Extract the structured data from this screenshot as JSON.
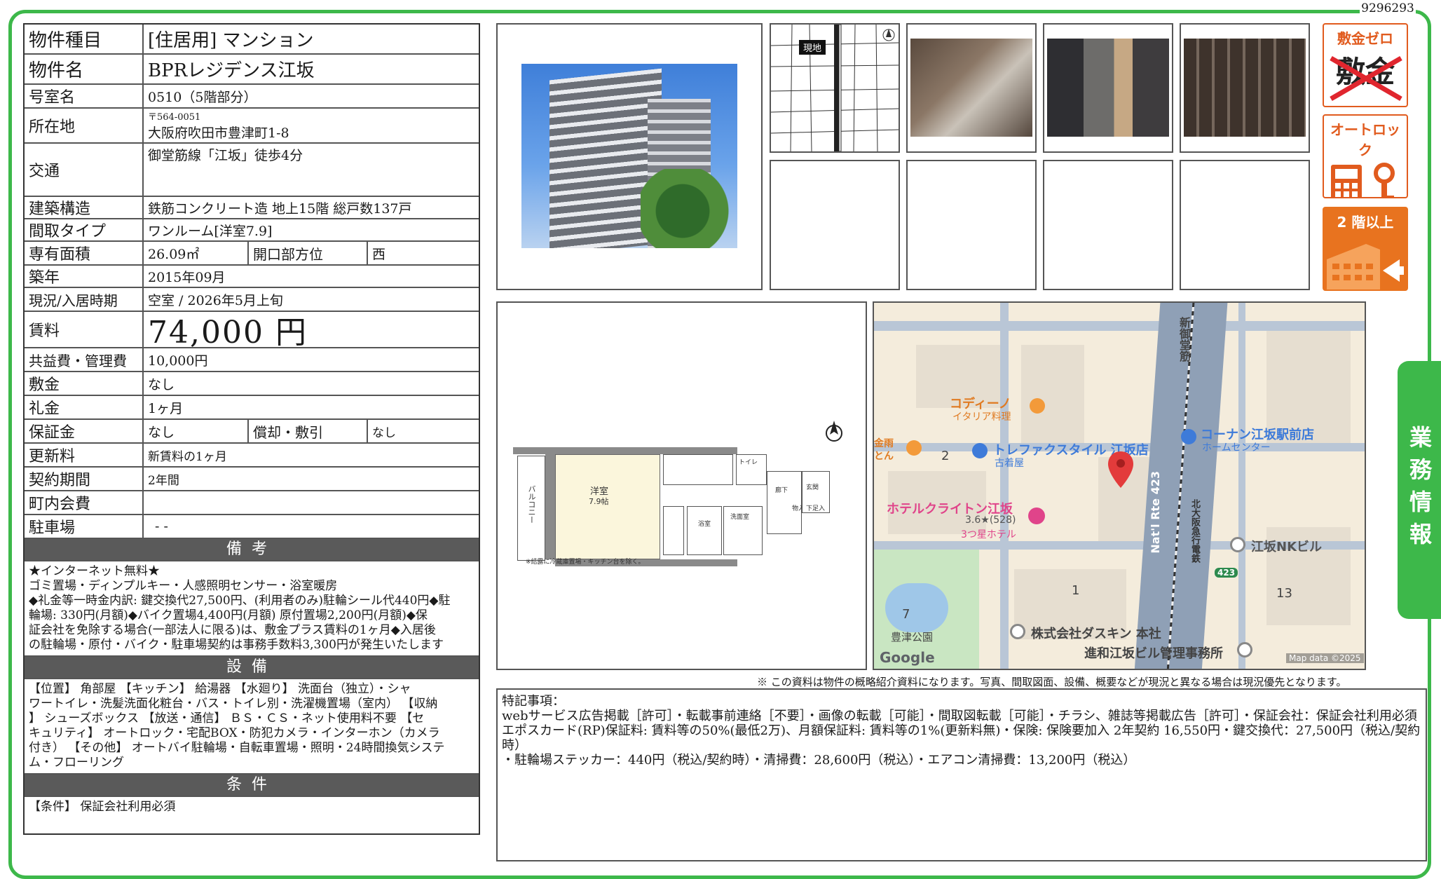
{
  "ref_id": "9296293",
  "side_tab": "業務情報",
  "spec": {
    "type_label": "物件種目",
    "type_value": "[住居用]  マンション",
    "name_label": "物件名",
    "name_value": "BPRレジデンス江坂",
    "room_label": "号室名",
    "room_value": "0510（5階部分）",
    "address_label": "所在地",
    "postal": "〒564-0051",
    "address_value": "大阪府吹田市豊津町1-8",
    "access_label": "交通",
    "access_value": "御堂筋線「江坂」徒歩4分",
    "structure_label": "建築構造",
    "structure_value": "鉄筋コンクリート造  地上15階  総戸数137戸",
    "layout_label": "間取タイプ",
    "layout_value": "ワンルーム[洋室7.9]",
    "area_label": "専有面積",
    "area_value": "26.09㎡",
    "direction_label": "開口部方位",
    "direction_value": "西",
    "built_label": "築年",
    "built_value": "2015年09月",
    "status_label": "現況/入居時期",
    "status_value": "空室  /  2026年5月上旬",
    "rent_label": "賃料",
    "rent_value": "74,000 円",
    "fee_label": "共益費・管理費",
    "fee_value": "10,000円",
    "deposit_label": "敷金",
    "deposit_value": "なし",
    "key_label": "礼金",
    "key_value": "1ヶ月",
    "guarantee_label": "保証金",
    "guarantee_value": "なし",
    "amort_label": "償却・敷引",
    "amort_value": "なし",
    "renew_label": "更新料",
    "renew_value": "新賃料の1ヶ月",
    "contract_label": "契約期間",
    "contract_value": "2年間",
    "town_label": "町内会費",
    "town_value": "",
    "parking_label": "駐車場",
    "parking_value": "- -"
  },
  "remarks": {
    "title": "備考",
    "lines": [
      "★インターネット無料★",
      "ゴミ置場・ディンプルキー・人感照明センサー・浴室暖房",
      "◆礼金等一時金内訳: 鍵交換代27,500円、(利用者のみ)駐輪シール代440円◆駐",
      "輪場: 330円(月額)◆バイク置場4,400円(月額)  原付置場2,200円(月額)◆保",
      "証会社を免除する場合(一部法人に限る)は、敷金プラス賃料の1ヶ月◆入居後",
      "の駐輪場・原付・バイク・駐車場契約は事務手数料3,300円が発生いたします"
    ]
  },
  "facilities": {
    "title": "設備",
    "lines": [
      "【位置】 角部屋 【キッチン】 給湯器 【水廻り】 洗面台（独立）・シャ",
      "ワートイレ・洗髪洗面化粧台・バス・トイレ別・洗濯機置場（室内） 【収納",
      "】 シューズボックス 【放送・通信】 ＢＳ・ＣＳ・ネット使用料不要 【セ",
      "キュリティ】 オートロック・宅配BOX・防犯カメラ・インターホン（カメラ",
      "付き） 【その他】 オートバイ駐輪場・自転車置場・照明・24時間換気システ",
      "ム・フローリング"
    ]
  },
  "conditions": {
    "title": "条件",
    "text": "【条件】 保証会社利用必須"
  },
  "badges": {
    "zero_title": "敷金ゼロ",
    "zero_crossed": "敷金",
    "autolock_title": "オートロック",
    "second_floor_title": "2 階以上"
  },
  "thumb_map": {
    "here_label": "現地"
  },
  "floor_plan": {
    "room": "洋室",
    "room_size": "7.9帖",
    "balcony": "バルコニー",
    "note": "※結露に冷蔵庫置場・キッチン台を除く。",
    "bath": "浴室",
    "washroom": "洗面室",
    "hall": "廊下",
    "entrance": "玄関",
    "toilet": "トイレ",
    "storage": "物入",
    "shoe": "下足入"
  },
  "map": {
    "road_name": "新御堂筋",
    "route_label": "Nat'l Rte 423",
    "rail_label": "北大阪急行電鉄",
    "route_shield": "423",
    "poi": [
      "コディーノ",
      "イタリア料理",
      "トレファクスタイル 江坂店",
      "古着屋",
      "コーナン江坂駅前店",
      "ホームセンター",
      "ホテルクライトン江坂",
      "3.6★(528)",
      "3つ星ホテル",
      "江坂NKビル",
      "株式会社ダスキン 本社",
      "進和江坂ビル管理事務所",
      "豊津公園",
      "金雨",
      "とん"
    ],
    "numbers": [
      "2",
      "1",
      "7",
      "13"
    ],
    "google": "Google",
    "attribution": "Map data ©2025"
  },
  "disclaimer": "※ この資料は物件の概略紹介資料になります。写真、間取図面、設備、概要などが現況と異なる場合は現況優先となります。",
  "special": {
    "title": "特記事項：",
    "lines": [
      "webサービス広告掲載［許可］・転載事前連絡［不要］・画像の転載［可能］・間取図転載［可能］・チラシ、雑誌等掲載広告［許可］・保証会社：保証会社利用必須",
      "エポスカード(RP)保証料: 賃料等の50%(最低2万)、月額保証料: 賃料等の1%(更新料無)・保険: 保険要加入 2年契約 16,550円・鍵交換代：27,500円（税込/契約時）",
      "・駐輪場ステッカー：440円（税込/契約時）・清掃費：28,600円（税込）・エアコン清掃費：13,200円（税込）"
    ]
  },
  "colors": {
    "frame": "#3db84a",
    "badge": "#e15b1e",
    "section_head": "#5a5a5a"
  }
}
